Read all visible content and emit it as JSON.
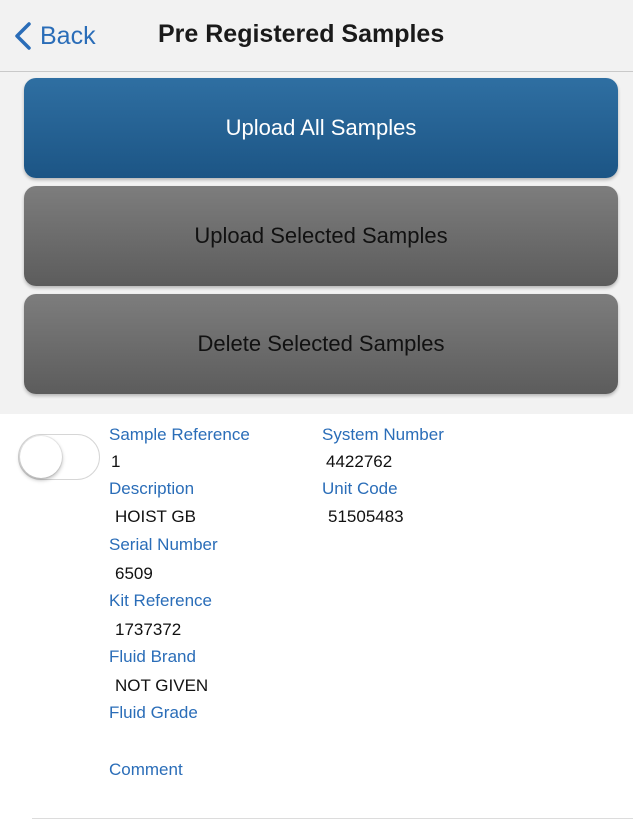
{
  "nav": {
    "back_label": "Back",
    "title": "Pre Registered Samples"
  },
  "actions": {
    "upload_all": "Upload All Samples",
    "upload_selected": "Upload Selected Samples",
    "delete_selected": "Delete Selected Samples"
  },
  "sample": {
    "selected": false,
    "fields": {
      "sample_reference": {
        "label": "Sample Reference",
        "value": "1"
      },
      "system_number": {
        "label": "System Number",
        "value": "4422762"
      },
      "description": {
        "label": "Description",
        "value": "HOIST GB"
      },
      "unit_code": {
        "label": "Unit Code",
        "value": "51505483"
      },
      "serial_number": {
        "label": "Serial Number",
        "value": "6509"
      },
      "kit_reference": {
        "label": "Kit Reference",
        "value": "1737372"
      },
      "fluid_brand": {
        "label": "Fluid Brand",
        "value": "NOT GIVEN"
      },
      "fluid_grade": {
        "label": "Fluid Grade",
        "value": ""
      },
      "comment": {
        "label": "Comment",
        "value": ""
      }
    }
  },
  "colors": {
    "accent": "#2a6db8",
    "primary_button": "#1f5b8c",
    "secondary_button": "#6b6b6b",
    "header_bg": "#f2f2f2"
  }
}
